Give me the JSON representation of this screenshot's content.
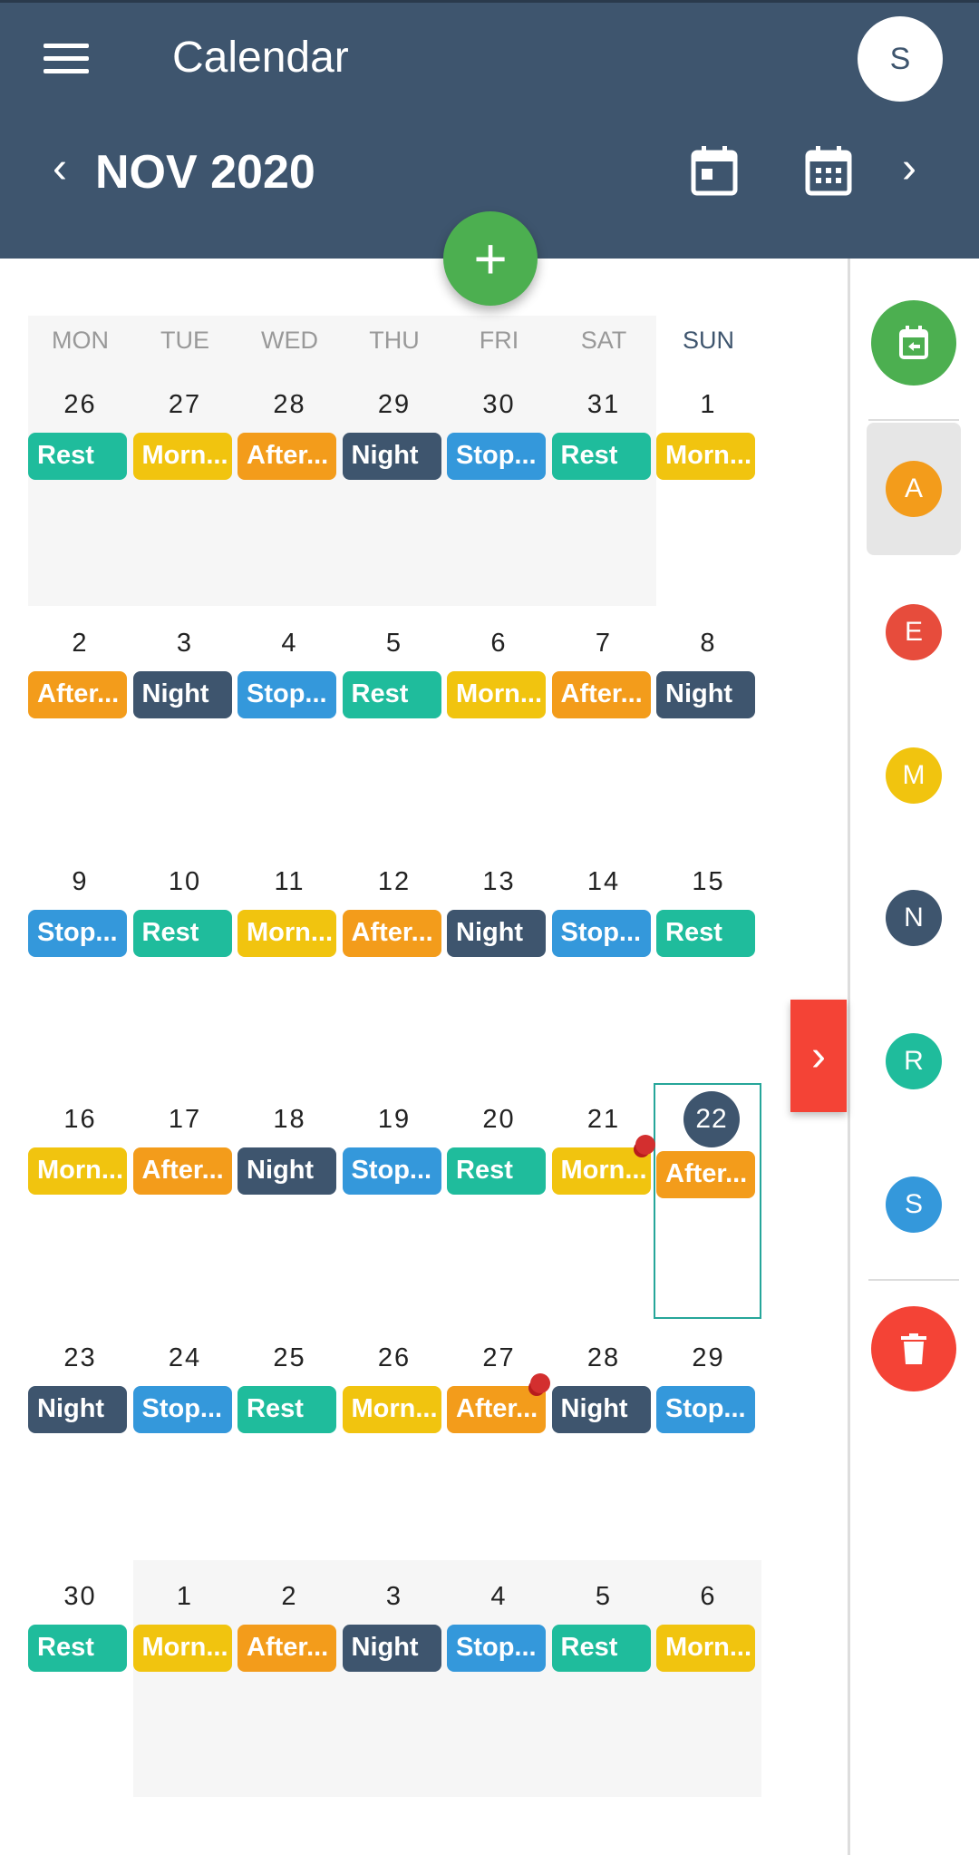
{
  "header": {
    "title": "Calendar",
    "user_initial": "S",
    "month": "NOV 2020",
    "icons": [
      "menu-icon",
      "calendar-day-icon",
      "calendar-month-icon",
      "chevron-left-icon",
      "chevron-right-icon"
    ]
  },
  "fab": {
    "label": "+"
  },
  "colors": {
    "Rest": "#1fbc9c",
    "Morning": "#f1c40f",
    "Afternoon": "#f39c1b",
    "Night": "#3e556e",
    "Stop": "#3498db"
  },
  "weekdays": [
    "MON",
    "TUE",
    "WED",
    "THU",
    "FRI",
    "SAT",
    "SUN"
  ],
  "weeks": [
    [
      {
        "d": "26",
        "l": "Rest",
        "t": "Rest",
        "m": 1
      },
      {
        "d": "27",
        "l": "Morn...",
        "t": "Morning",
        "m": 1
      },
      {
        "d": "28",
        "l": "After...",
        "t": "Afternoon",
        "m": 1
      },
      {
        "d": "29",
        "l": "Night",
        "t": "Night",
        "m": 1
      },
      {
        "d": "30",
        "l": "Stop...",
        "t": "Stop",
        "m": 1
      },
      {
        "d": "31",
        "l": "Rest",
        "t": "Rest",
        "m": 1
      },
      {
        "d": "1",
        "l": "Morn...",
        "t": "Morning"
      }
    ],
    [
      {
        "d": "2",
        "l": "After...",
        "t": "Afternoon"
      },
      {
        "d": "3",
        "l": "Night",
        "t": "Night"
      },
      {
        "d": "4",
        "l": "Stop...",
        "t": "Stop"
      },
      {
        "d": "5",
        "l": "Rest",
        "t": "Rest"
      },
      {
        "d": "6",
        "l": "Morn...",
        "t": "Morning"
      },
      {
        "d": "7",
        "l": "After...",
        "t": "Afternoon"
      },
      {
        "d": "8",
        "l": "Night",
        "t": "Night"
      }
    ],
    [
      {
        "d": "9",
        "l": "Stop...",
        "t": "Stop"
      },
      {
        "d": "10",
        "l": "Rest",
        "t": "Rest"
      },
      {
        "d": "11",
        "l": "Morn...",
        "t": "Morning"
      },
      {
        "d": "12",
        "l": "After...",
        "t": "Afternoon"
      },
      {
        "d": "13",
        "l": "Night",
        "t": "Night"
      },
      {
        "d": "14",
        "l": "Stop...",
        "t": "Stop"
      },
      {
        "d": "15",
        "l": "Rest",
        "t": "Rest"
      }
    ],
    [
      {
        "d": "16",
        "l": "Morn...",
        "t": "Morning"
      },
      {
        "d": "17",
        "l": "After...",
        "t": "Afternoon"
      },
      {
        "d": "18",
        "l": "Night",
        "t": "Night"
      },
      {
        "d": "19",
        "l": "Stop...",
        "t": "Stop"
      },
      {
        "d": "20",
        "l": "Rest",
        "t": "Rest"
      },
      {
        "d": "21",
        "l": "Morn...",
        "t": "Morning",
        "pin": 1
      },
      {
        "d": "22",
        "l": "After...",
        "t": "Afternoon",
        "today": 1
      }
    ],
    [
      {
        "d": "23",
        "l": "Night",
        "t": "Night"
      },
      {
        "d": "24",
        "l": "Stop...",
        "t": "Stop"
      },
      {
        "d": "25",
        "l": "Rest",
        "t": "Rest"
      },
      {
        "d": "26",
        "l": "Morn...",
        "t": "Morning"
      },
      {
        "d": "27",
        "l": "After...",
        "t": "Afternoon",
        "pin": 1
      },
      {
        "d": "28",
        "l": "Night",
        "t": "Night"
      },
      {
        "d": "29",
        "l": "Stop...",
        "t": "Stop"
      }
    ],
    [
      {
        "d": "30",
        "l": "Rest",
        "t": "Rest"
      },
      {
        "d": "1",
        "l": "Morn...",
        "t": "Morning",
        "m": 1
      },
      {
        "d": "2",
        "l": "After...",
        "t": "Afternoon",
        "m": 1
      },
      {
        "d": "3",
        "l": "Night",
        "t": "Night",
        "m": 1
      },
      {
        "d": "4",
        "l": "Stop...",
        "t": "Stop",
        "m": 1
      },
      {
        "d": "5",
        "l": "Rest",
        "t": "Rest",
        "m": 1
      },
      {
        "d": "6",
        "l": "Morn...",
        "t": "Morning",
        "m": 1
      }
    ]
  ],
  "sidebar": {
    "users": [
      {
        "initial": "A",
        "color": "#f39c1b",
        "selected": true
      },
      {
        "initial": "E",
        "color": "#e74c3c"
      },
      {
        "initial": "M",
        "color": "#f1c40f"
      },
      {
        "initial": "N",
        "color": "#3e556e"
      },
      {
        "initial": "R",
        "color": "#1fbc9c"
      },
      {
        "initial": "S",
        "color": "#3498db"
      }
    ],
    "icons": [
      "calendar-import-icon",
      "delete-icon",
      "chevron-right-icon"
    ]
  }
}
